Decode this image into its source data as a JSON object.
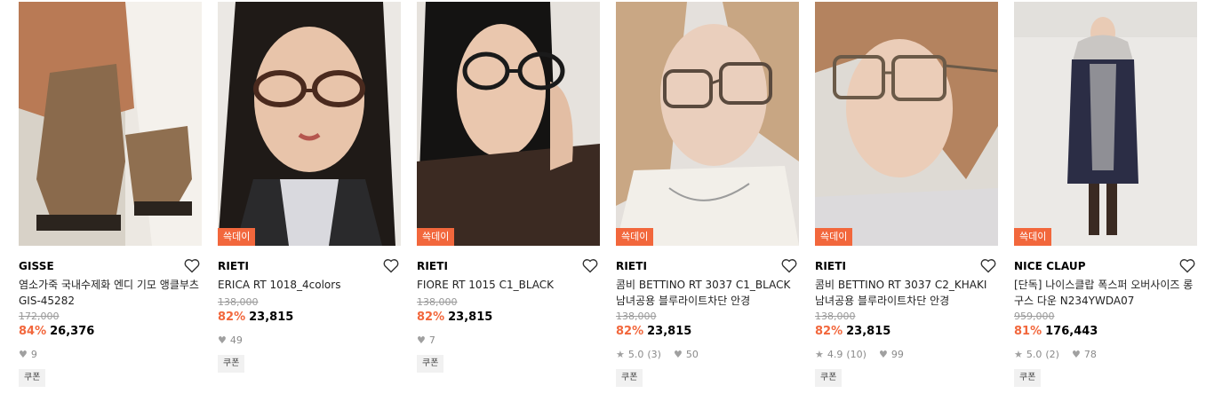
{
  "products": [
    {
      "brand": "GISSE",
      "name": "염소가죽 국내수제화 엔디 기모 앵클부츠 GIS-45282",
      "badge": "",
      "original_price": "172,000",
      "discount": "84%",
      "price": "26,376",
      "rating": "",
      "reviews": "",
      "likes": "9",
      "coupon": "쿠폰"
    },
    {
      "brand": "RIETI",
      "name": "ERICA RT 1018_4colors",
      "badge": "쓱데이",
      "original_price": "138,000",
      "discount": "82%",
      "price": "23,815",
      "rating": "",
      "reviews": "",
      "likes": "49",
      "coupon": "쿠폰"
    },
    {
      "brand": "RIETI",
      "name": "FIORE RT 1015 C1_BLACK",
      "badge": "쓱데이",
      "original_price": "138,000",
      "discount": "82%",
      "price": "23,815",
      "rating": "",
      "reviews": "",
      "likes": "7",
      "coupon": "쿠폰"
    },
    {
      "brand": "RIETI",
      "name": "콤비 BETTINO RT 3037 C1_BLACK 남녀공용 블루라이트차단 안경",
      "badge": "쓱데이",
      "original_price": "138,000",
      "discount": "82%",
      "price": "23,815",
      "rating": "5.0",
      "reviews": "(3)",
      "likes": "50",
      "coupon": "쿠폰"
    },
    {
      "brand": "RIETI",
      "name": "콤비 BETTINO RT 3037 C2_KHAKI 남녀공용 블루라이트차단 안경",
      "badge": "쓱데이",
      "original_price": "138,000",
      "discount": "82%",
      "price": "23,815",
      "rating": "4.9",
      "reviews": "(10)",
      "likes": "99",
      "coupon": "쿠폰"
    },
    {
      "brand": "NICE CLAUP",
      "name": "[단독] 나이스클랍 폭스퍼 오버사이즈 롱 구스 다운 N234YWDA07",
      "badge": "쓱데이",
      "original_price": "959,000",
      "discount": "81%",
      "price": "176,443",
      "rating": "5.0",
      "reviews": "(2)",
      "likes": "78",
      "coupon": "쿠폰"
    }
  ],
  "colors": {
    "accent": "#f2673c",
    "muted": "#9a9a9a"
  }
}
